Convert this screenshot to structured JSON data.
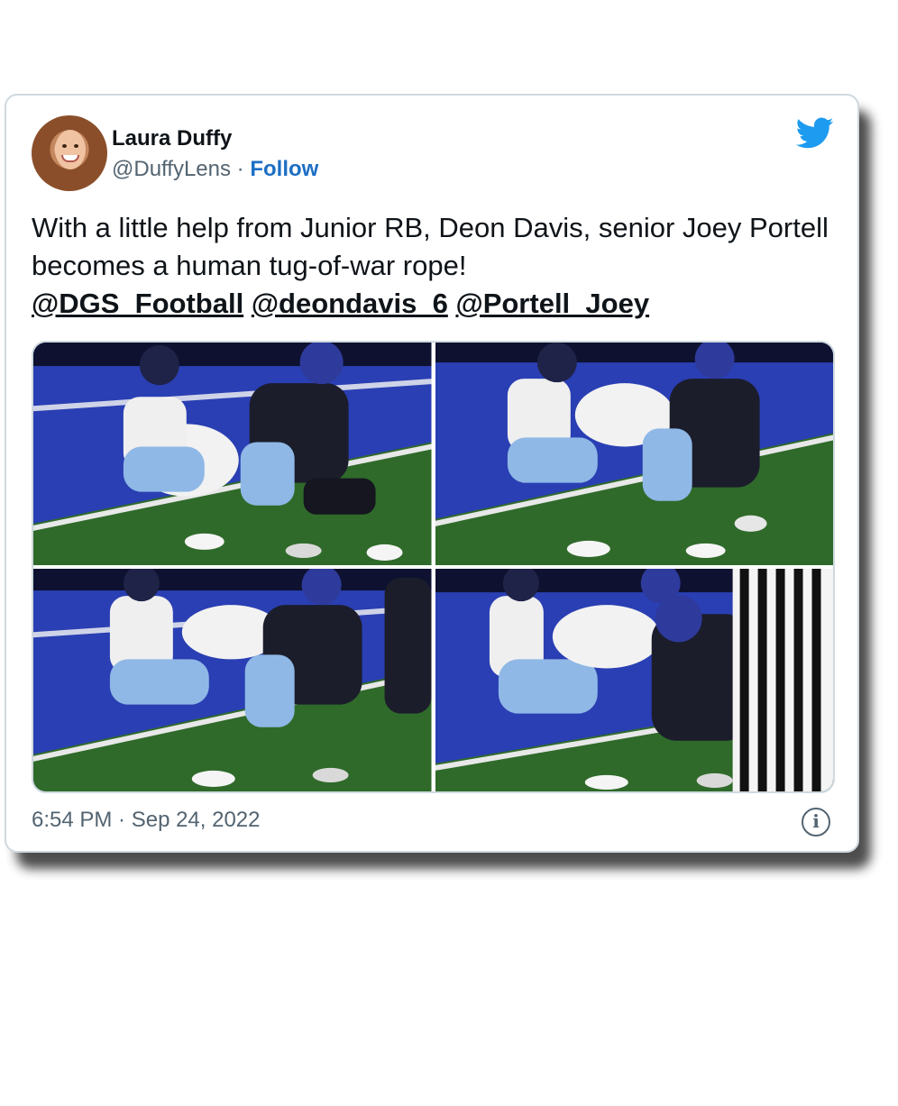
{
  "author": {
    "name": "Laura Duffy",
    "handle": "@DuffyLens",
    "separator": "·",
    "follow_label": "Follow",
    "avatar_icon": "avatar-photo"
  },
  "brand": {
    "icon": "twitter-bird-icon",
    "color": "#1d9bf0"
  },
  "tweet": {
    "text": "With a little help from Junior RB, Deon Davis, senior Joey Portell becomes a human tug-of-war rope!",
    "mentions": [
      "@DGS_Football",
      "@deondavis_6",
      "@Portell_Joey"
    ]
  },
  "media": {
    "photos": [
      {
        "label": "football-photo-1"
      },
      {
        "label": "football-photo-2"
      },
      {
        "label": "football-photo-3"
      },
      {
        "label": "football-photo-4"
      }
    ]
  },
  "footer": {
    "timestamp": "6:54 PM · Sep 24, 2022",
    "info_label": "i"
  },
  "colors": {
    "link": "#1d6fc4",
    "secondary_text": "#536471",
    "border": "#cfd9de"
  }
}
